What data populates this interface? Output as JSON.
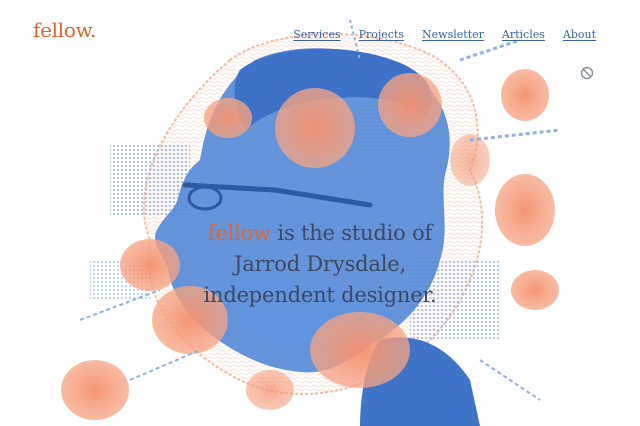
{
  "brand": {
    "logo": "fellow.",
    "color": "#e0652c"
  },
  "nav": {
    "items": [
      {
        "label": "Services"
      },
      {
        "label": "Projects"
      },
      {
        "label": "Newsletter"
      },
      {
        "label": "Articles"
      },
      {
        "label": "About"
      }
    ],
    "color": "#3a63a8"
  },
  "hero": {
    "brand_word": "fellow",
    "line1_rest": " is the studio of",
    "line2": "Jarrod Drysdale,",
    "line3": "independent designer."
  },
  "icons": {
    "status": "no-symbol-icon"
  },
  "artwork": {
    "subject": "portrait-illustration",
    "blue": "#4f86d6",
    "orange": "#f3916c"
  }
}
